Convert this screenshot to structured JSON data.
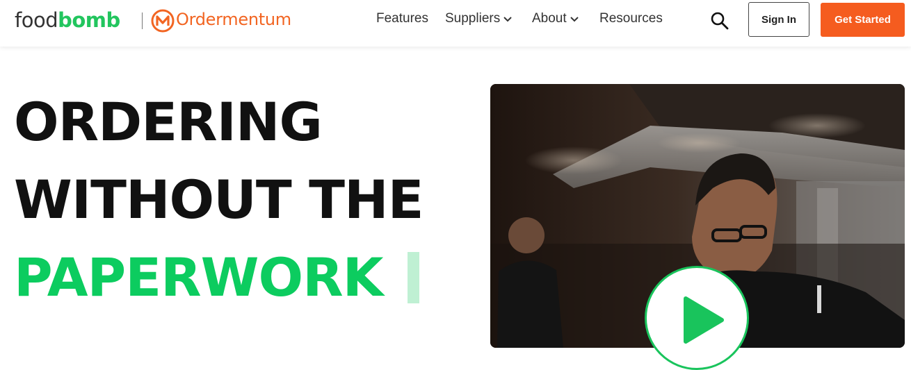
{
  "brand": {
    "food": "food",
    "bomb": "bomb",
    "partner": "Ordermentum",
    "colors": {
      "green": "#22c55e",
      "orange": "#f26522"
    }
  },
  "nav": {
    "features": "Features",
    "suppliers": "Suppliers",
    "about": "About",
    "resources": "Resources"
  },
  "actions": {
    "sign_in": "Sign In",
    "get_started": "Get Started"
  },
  "hero": {
    "line1": "ORDERING",
    "line2": "WITHOUT THE",
    "line3": "PAPERWORK",
    "accent": "#0ccc5f"
  },
  "icons": {
    "search": "search-icon",
    "chevron": "chevron-down-icon",
    "play": "play-icon"
  }
}
